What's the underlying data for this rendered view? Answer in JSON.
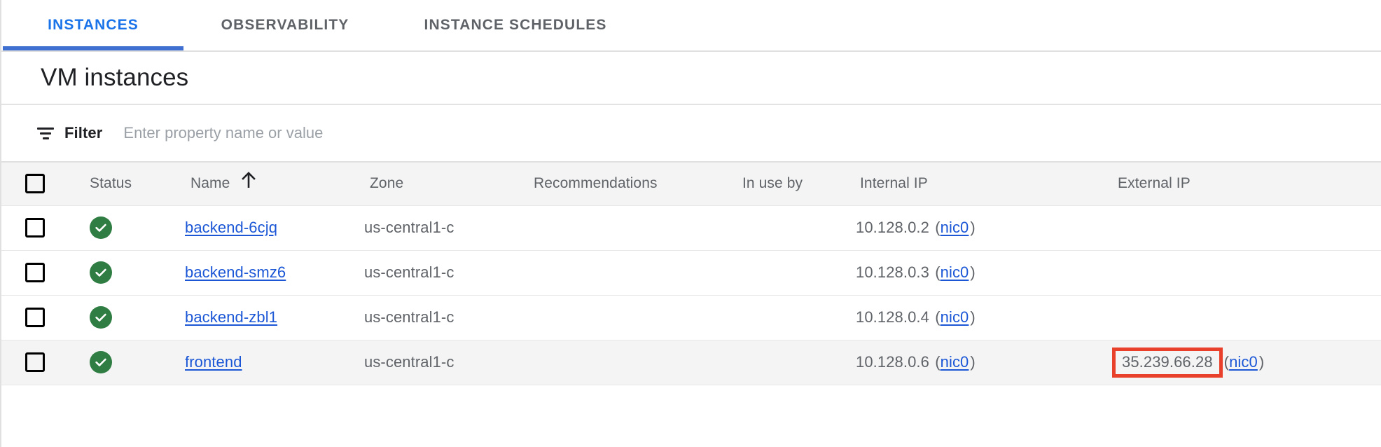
{
  "tabs": [
    {
      "label": "INSTANCES",
      "active": true
    },
    {
      "label": "OBSERVABILITY",
      "active": false
    },
    {
      "label": "INSTANCE SCHEDULES",
      "active": false
    }
  ],
  "page_title": "VM instances",
  "filter": {
    "icon": "filter-list-icon",
    "label": "Filter",
    "value": "",
    "placeholder": "Enter property name or value"
  },
  "table": {
    "columns": [
      {
        "key": "checkbox",
        "label": ""
      },
      {
        "key": "status",
        "label": "Status"
      },
      {
        "key": "name",
        "label": "Name",
        "sort": "ascending",
        "sort_glyph": "arrow-upward-icon"
      },
      {
        "key": "zone",
        "label": "Zone"
      },
      {
        "key": "recommendations",
        "label": "Recommendations"
      },
      {
        "key": "in_use_by",
        "label": "In use by"
      },
      {
        "key": "internal_ip",
        "label": "Internal IP"
      },
      {
        "key": "external_ip",
        "label": "External IP"
      }
    ],
    "rows": [
      {
        "checked": false,
        "status": "running",
        "status_icon": "check-circle-icon",
        "name": "backend-6cjq",
        "zone": "us-central1-c",
        "recommendations": "",
        "in_use_by": "",
        "internal_ip": "10.128.0.2",
        "internal_nic": "nic0",
        "external_ip": "",
        "external_nic": "",
        "highlighted": false,
        "hovered": false
      },
      {
        "checked": false,
        "status": "running",
        "status_icon": "check-circle-icon",
        "name": "backend-smz6",
        "zone": "us-central1-c",
        "recommendations": "",
        "in_use_by": "",
        "internal_ip": "10.128.0.3",
        "internal_nic": "nic0",
        "external_ip": "",
        "external_nic": "",
        "highlighted": false,
        "hovered": false
      },
      {
        "checked": false,
        "status": "running",
        "status_icon": "check-circle-icon",
        "name": "backend-zbl1",
        "zone": "us-central1-c",
        "recommendations": "",
        "in_use_by": "",
        "internal_ip": "10.128.0.4",
        "internal_nic": "nic0",
        "external_ip": "",
        "external_nic": "",
        "highlighted": false,
        "hovered": false
      },
      {
        "checked": false,
        "status": "running",
        "status_icon": "check-circle-icon",
        "name": "frontend",
        "zone": "us-central1-c",
        "recommendations": "",
        "in_use_by": "",
        "internal_ip": "10.128.0.6",
        "internal_nic": "nic0",
        "external_ip": "35.239.66.28",
        "external_nic": "nic0",
        "highlighted": true,
        "hovered": true
      }
    ]
  },
  "colors": {
    "accent_blue": "#1a73e8",
    "tab_underline": "#3f6fd1",
    "link_blue": "#1a56d6",
    "status_green": "#2f7d43",
    "annotation_red": "#e8402a",
    "header_bg": "#f4f4f4",
    "row_hover_bg": "#f4f4f4",
    "text_primary": "#202124",
    "text_secondary": "#5f6368",
    "placeholder": "#9aa0a6",
    "divider": "#e0e0e0"
  }
}
